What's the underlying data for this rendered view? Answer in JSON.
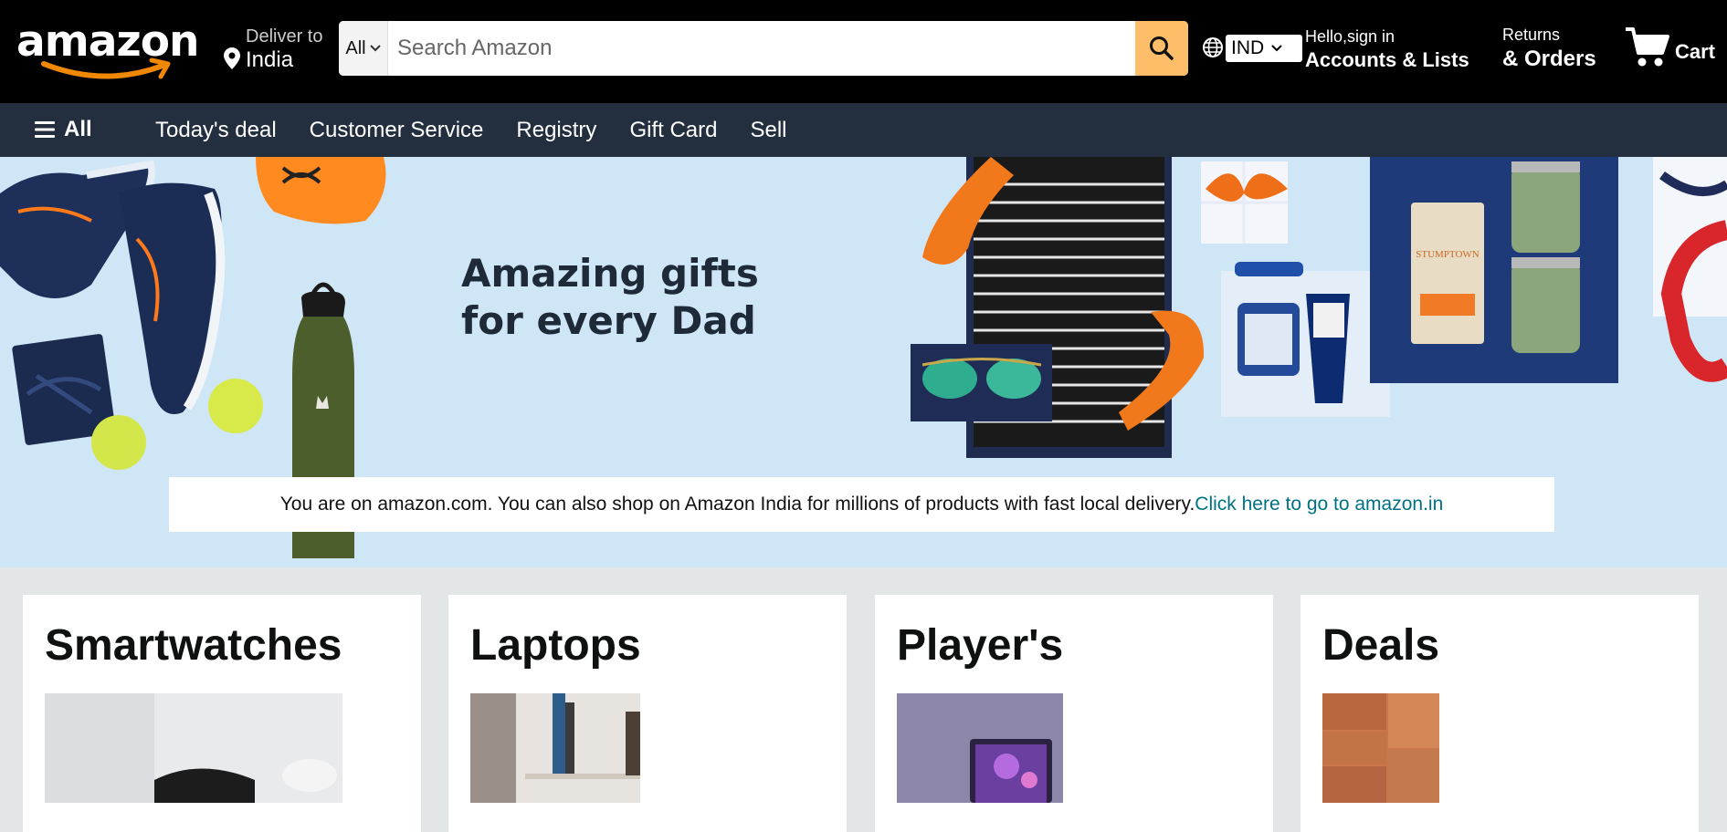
{
  "header": {
    "logo": "amazon",
    "deliver_label": "Deliver to",
    "deliver_location": "India",
    "search_category": "All",
    "search_placeholder": "Search Amazon",
    "language": "IND",
    "account_greeting": "Hello,sign in",
    "account_label": "Accounts & Lists",
    "returns_label": "Returns",
    "orders_label": "& Orders",
    "cart_label": "Cart"
  },
  "nav": {
    "all_label": "All",
    "links": [
      "Today's deal",
      "Customer Service",
      "Registry",
      "Gift Card",
      "Sell"
    ]
  },
  "hero": {
    "title_line1": "Amazing gifts",
    "title_line2": "for every Dad",
    "notice_text": "You are on amazon.com. You can also shop on Amazon India for millions of products with fast local delivery.",
    "notice_link": "Click here to go to amazon.in"
  },
  "cards": [
    {
      "title": "Smartwatches"
    },
    {
      "title": "Laptops"
    },
    {
      "title": "Player's"
    },
    {
      "title": "Deals"
    }
  ],
  "colors": {
    "header_bg": "#000000",
    "nav_bg": "#232f3e",
    "search_button": "#febd69",
    "link": "#007185",
    "hero_bg": "#cfe6f7",
    "page_bg": "#e3e6e6"
  },
  "icons": [
    "location-pin-icon",
    "chevron-down-icon",
    "search-icon",
    "globe-icon",
    "cart-icon",
    "hamburger-icon"
  ]
}
